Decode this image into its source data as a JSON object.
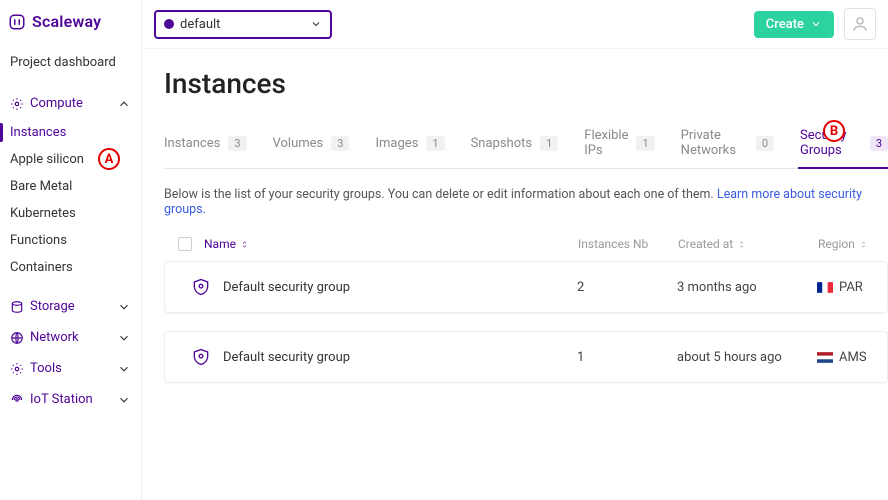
{
  "brand": {
    "name": "Scaleway"
  },
  "topbar": {
    "project": {
      "label": "default"
    },
    "create_label": "Create"
  },
  "sidebar": {
    "dashboard_label": "Project dashboard",
    "groups": {
      "compute": {
        "label": "Compute",
        "expanded": true
      },
      "storage": {
        "label": "Storage",
        "expanded": false
      },
      "network": {
        "label": "Network",
        "expanded": false
      },
      "tools": {
        "label": "Tools",
        "expanded": false
      },
      "iot": {
        "label": "IoT Station",
        "expanded": false
      }
    },
    "compute_items": [
      {
        "label": "Instances",
        "active": true
      },
      {
        "label": "Apple silicon"
      },
      {
        "label": "Bare Metal"
      },
      {
        "label": "Kubernetes"
      },
      {
        "label": "Functions"
      },
      {
        "label": "Containers"
      }
    ]
  },
  "page": {
    "title": "Instances",
    "tabs": [
      {
        "label": "Instances",
        "count": "3"
      },
      {
        "label": "Volumes",
        "count": "3"
      },
      {
        "label": "Images",
        "count": "1"
      },
      {
        "label": "Snapshots",
        "count": "1"
      },
      {
        "label": "Flexible IPs",
        "count": "1"
      },
      {
        "label": "Private Networks",
        "count": "0"
      },
      {
        "label": "Security Groups",
        "count": "3",
        "active": true
      }
    ],
    "description": {
      "text": "Below is the list of your security groups. You can delete or edit information about each one of them. ",
      "link": "Learn more about security groups."
    },
    "columns": {
      "name": "Name",
      "instances_nb": "Instances Nb",
      "created_at": "Created at",
      "region": "Region"
    },
    "rows": [
      {
        "name": "Default security group",
        "instances_nb": "2",
        "created_at": "3 months ago",
        "region": "PAR",
        "flag": "fr"
      },
      {
        "name": "Default security group",
        "instances_nb": "1",
        "created_at": "about 5 hours ago",
        "region": "AMS",
        "flag": "nl"
      }
    ]
  },
  "annotations": {
    "a": "A",
    "b": "B"
  }
}
